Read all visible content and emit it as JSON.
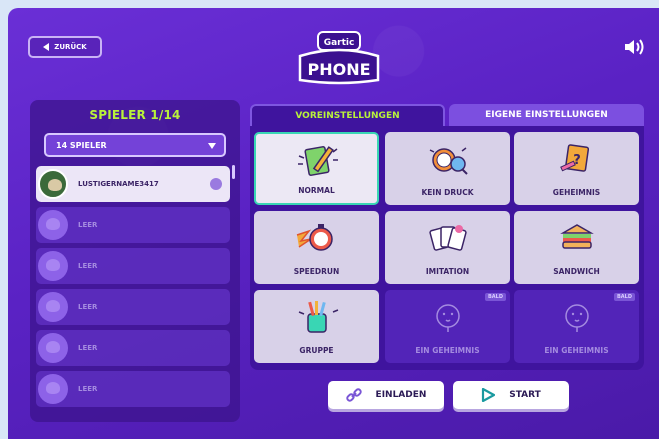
{
  "header": {
    "back_label": "ZURÜCK",
    "logo_top": "Gartic",
    "logo_bottom": "PHONE"
  },
  "players": {
    "title": "SPIELER 1/14",
    "select_value": "14 SPIELER",
    "items": [
      {
        "name": "LUSTIGERNAME3417"
      },
      {
        "name": "LEER"
      },
      {
        "name": "LEER"
      },
      {
        "name": "LEER"
      },
      {
        "name": "LEER"
      },
      {
        "name": "LEER"
      }
    ]
  },
  "tabs": {
    "active": "VOREINSTELLUNGEN",
    "inactive": "EIGENE EINSTELLUNGEN"
  },
  "modes": [
    {
      "label": "NORMAL"
    },
    {
      "label": "KEIN DRUCK"
    },
    {
      "label": "GEHEIMNIS"
    },
    {
      "label": "SPEEDRUN"
    },
    {
      "label": "IMITATION"
    },
    {
      "label": "SANDWICH"
    },
    {
      "label": "GRUPPE"
    },
    {
      "label": "EIN GEHEIMNIS",
      "badge": "BALD"
    },
    {
      "label": "EIN GEHEIMNIS",
      "badge": "BALD"
    }
  ],
  "actions": {
    "invite_label": "EINLADEN",
    "start_label": "START"
  },
  "colors": {
    "accent_green": "#b9f23a",
    "selected_border": "#39d6b4",
    "panel_purple": "#3f149e"
  }
}
